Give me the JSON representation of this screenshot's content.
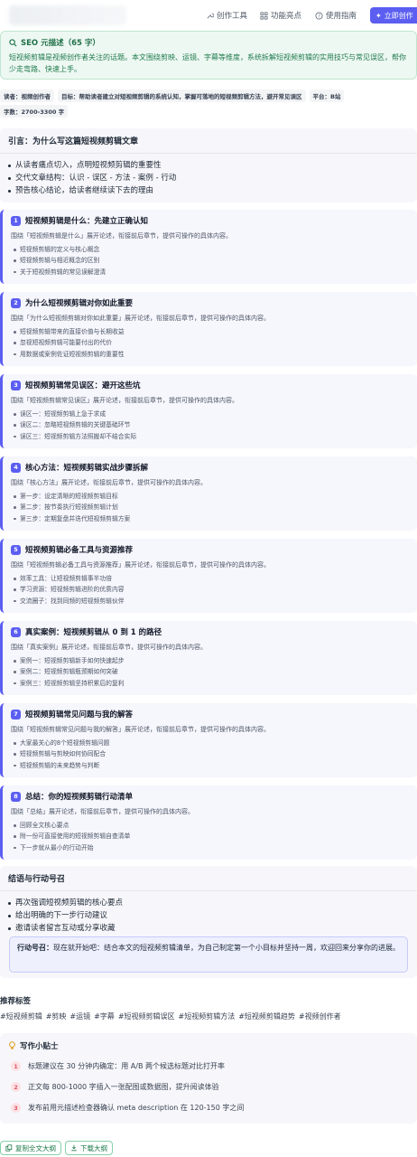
{
  "nav": {
    "tools": "创作工具",
    "features": "功能亮点",
    "guide": "使用指南",
    "cta": "立即创作"
  },
  "seo": {
    "title": "SEO 元描述（65 字）",
    "text": "短视频剪辑是视频创作者关注的话题。本文围绕剪映、运镜、字幕等维度，系统拆解短视频剪辑的实用技巧与常见误区，帮你少走弯路、快速上手。"
  },
  "meta": {
    "reader": "读者：视频创作者",
    "goal": "目标：帮助读者建立对短视频剪辑的系统认知，掌握可落地的短视频剪辑方法，避开常见误区",
    "platform": "平台：B站",
    "words": "字数：2700-3300 字"
  },
  "intro": {
    "title": "引言：为什么写这篇短视频剪辑文章",
    "bullets": [
      "从读者痛点切入，点明短视频剪辑的重要性",
      "交代文章结构：认识 - 误区 - 方法 - 案例 - 行动",
      "预告核心结论，给读者继续读下去的理由"
    ]
  },
  "sections": [
    {
      "num": "1",
      "title": "短视频剪辑是什么：先建立正确认知",
      "desc": "围绕「短视频剪辑是什么」展开论述，衔接前后章节，提供可操作的具体内容。",
      "items": [
        "短视频剪辑的定义与核心概念",
        "短视频剪辑与相近概念的区别",
        "关于短视频剪辑的常见误解澄清"
      ]
    },
    {
      "num": "2",
      "title": "为什么短视频剪辑对你如此重要",
      "desc": "围绕「为什么短视频剪辑对你如此重要」展开论述，衔接前后章节，提供可操作的具体内容。",
      "items": [
        "短视频剪辑带来的直接价值与长期收益",
        "忽视短视频剪辑可能要付出的代价",
        "用数据或案例佐证短视频剪辑的重要性"
      ]
    },
    {
      "num": "3",
      "title": "短视频剪辑常见误区：避开这些坑",
      "desc": "围绕「短视频剪辑常见误区」展开论述，衔接前后章节，提供可操作的具体内容。",
      "items": [
        "误区一：短视频剪辑上急于求成",
        "误区二：忽略短视频剪辑的关键基础环节",
        "误区三：短视频剪辑方法照搬却不结合实际"
      ]
    },
    {
      "num": "4",
      "title": "核心方法：短视频剪辑实战步骤拆解",
      "desc": "围绕「核心方法」展开论述，衔接前后章节，提供可操作的具体内容。",
      "items": [
        "第一步：设定清晰的短视频剪辑目标",
        "第二步：按节奏执行短视频剪辑计划",
        "第三步：定期复盘并迭代短视频剪辑方案"
      ]
    },
    {
      "num": "5",
      "title": "短视频剪辑必备工具与资源推荐",
      "desc": "围绕「短视频剪辑必备工具与资源推荐」展开论述，衔接前后章节，提供可操作的具体内容。",
      "items": [
        "效率工具：让短视频剪辑事半功倍",
        "学习资源：短视频剪辑进阶的优质内容",
        "交流圈子：找到同频的短视频剪辑伙伴"
      ]
    },
    {
      "num": "6",
      "title": "真实案例：短视频剪辑从 0 到 1 的路径",
      "desc": "围绕「真实案例」展开论述，衔接前后章节，提供可操作的具体内容。",
      "items": [
        "案例一：短视频剪辑新手如何快速起步",
        "案例二：短视频剪辑瓶颈期如何突破",
        "案例三：短视频剪辑坚持积累后的复利"
      ]
    },
    {
      "num": "7",
      "title": "短视频剪辑常见问题与我的解答",
      "desc": "围绕「短视频剪辑常见问题与我的解答」展开论述，衔接前后章节，提供可操作的具体内容。",
      "items": [
        "大家最关心的8个短视频剪辑问题",
        "短视频剪辑与剪映如何协同配合",
        "短视频剪辑的未来趋势与判断"
      ]
    },
    {
      "num": "8",
      "title": "总结：你的短视频剪辑行动清单",
      "desc": "围绕「总结」展开论述，衔接前后章节，提供可操作的具体内容。",
      "items": [
        "回顾全文核心要点",
        "附一份可直接使用的短视频剪辑自查清单",
        "下一步就从最小的行动开始"
      ]
    }
  ],
  "conclusion": {
    "title": "结语与行动号召",
    "bullets": [
      "再次强调短视频剪辑的核心要点",
      "给出明确的下一步行动建议",
      "邀请读者留言互动或分享收藏"
    ],
    "cta_label": "行动号召：",
    "cta_text": "现在就开始吧：结合本文的短视频剪辑清单，为自己制定第一个小目标并坚持一周，欢迎回来分享你的进展。"
  },
  "tags": {
    "title": "推荐标签",
    "items": [
      "#短视频剪辑",
      "#剪映",
      "#运镜",
      "#字幕",
      "#短视频剪辑误区",
      "#短视频剪辑方法",
      "#短视频剪辑趋势",
      "#视频创作者"
    ]
  },
  "tips": {
    "title": "写作小贴士",
    "items": [
      {
        "n": "1",
        "text": "标题建议在 30 分钟内确定：用 A/B 两个候选标题对比打开率"
      },
      {
        "n": "2",
        "text": "正文每 800-1000 字插入一张配图或数据图，提升阅读体验"
      },
      {
        "n": "3",
        "text": "发布前用元描述检查器确认 meta description 在 120-150 字之间"
      }
    ]
  },
  "actions": {
    "copy": "复制全文大纲",
    "download": "下载大纲"
  },
  "colors": {
    "accent": "#5b5ef0",
    "green": "#1f7a4b",
    "tip_badge": "#e0566b"
  }
}
